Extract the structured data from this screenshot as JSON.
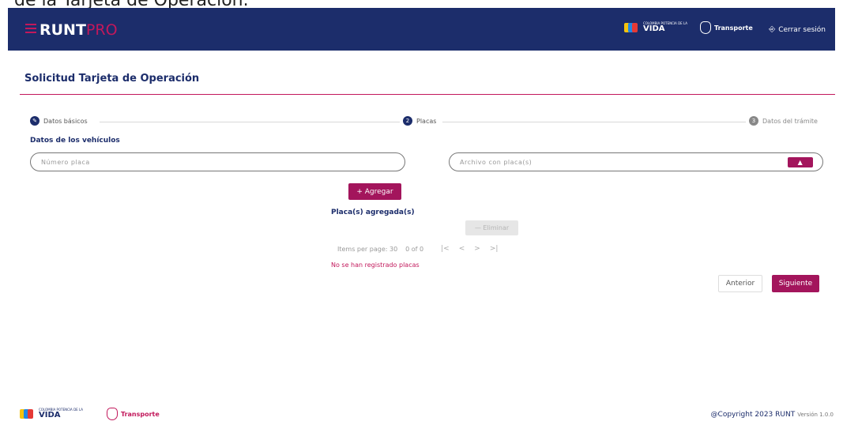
{
  "page": {
    "top_caption": "de la Tarjeta de Operación."
  },
  "header": {
    "brand_main": "RUNT",
    "brand_suffix": "PRO",
    "logo_vida_small": "COLOMBIA POTENCIA DE LA",
    "logo_vida_big": "VIDA",
    "logo_transporte": "Transporte",
    "logout_label": "Cerrar sesión",
    "colors": {
      "bar": "#1c2d6b",
      "accent": "#c2185b"
    }
  },
  "main": {
    "title": "Solicitud Tarjeta de Operación",
    "stepper": {
      "steps": [
        {
          "label": "Datos básicos",
          "marker": "✎",
          "state": "done"
        },
        {
          "label": "Placas",
          "marker": "2",
          "state": "active"
        },
        {
          "label": "Datos del trámite",
          "marker": "3",
          "state": "pending"
        }
      ]
    },
    "section_label": "Datos de los vehículos",
    "plate_input": {
      "placeholder": "Número placa",
      "value": ""
    },
    "file_input": {
      "placeholder": "Archivo con placa(s)",
      "value": "",
      "upload_icon": "upload-icon"
    },
    "add_button": "+ Agregar",
    "added_heading": "Placa(s) agregada(s)",
    "delete_button": "— Eliminar",
    "paginator": {
      "items_per_page": "Items per page: 30",
      "range": "0 of 0",
      "first": "|<",
      "prev": "<",
      "next": ">",
      "last": ">|"
    },
    "empty_message": "No se han registrado placas",
    "prev_button": "Anterior",
    "next_button": "Siguiente"
  },
  "footer": {
    "logo_vida_small": "COLOMBIA POTENCIA DE LA",
    "logo_vida_big": "VIDA",
    "logo_transporte": "Transporte",
    "copyright": "@Copyright 2023 RUNT",
    "version": "Versión 1.0.0"
  }
}
